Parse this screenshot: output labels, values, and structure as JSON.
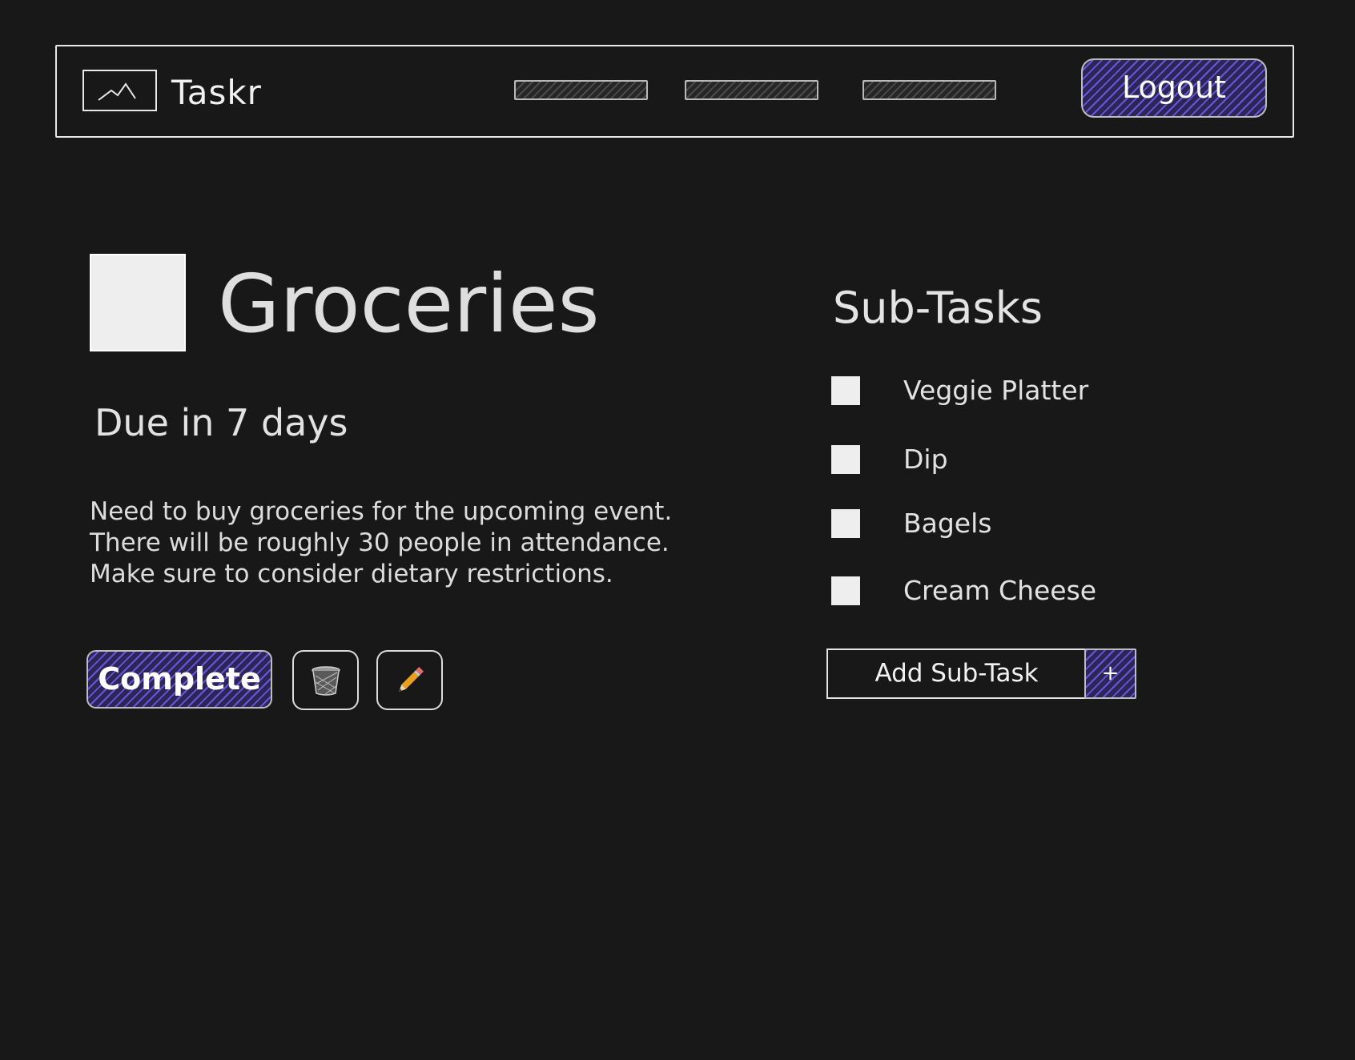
{
  "header": {
    "brand": "Taskr",
    "logout_label": "Logout",
    "nav_links": [
      "",
      "",
      ""
    ]
  },
  "task": {
    "title": "Groceries",
    "due": "Due in 7 days",
    "description_lines": [
      "Need to buy groceries for the upcoming event.",
      "There will be roughly 30 people in attendance.",
      "Make sure to consider dietary restrictions."
    ],
    "complete_label": "Complete",
    "delete_icon": "trash-icon",
    "edit_icon": "pencil-icon"
  },
  "subtasks": {
    "heading": "Sub-Tasks",
    "items": [
      {
        "label": "Veggie Platter",
        "checked": false
      },
      {
        "label": "Dip",
        "checked": false
      },
      {
        "label": "Bagels",
        "checked": false
      },
      {
        "label": "Cream Cheese",
        "checked": false
      }
    ],
    "add_label": "Add Sub-Task",
    "add_plus": "+"
  },
  "colors": {
    "background": "#181818",
    "accent": "#6a55d8",
    "stroke": "#e8e8e8"
  }
}
